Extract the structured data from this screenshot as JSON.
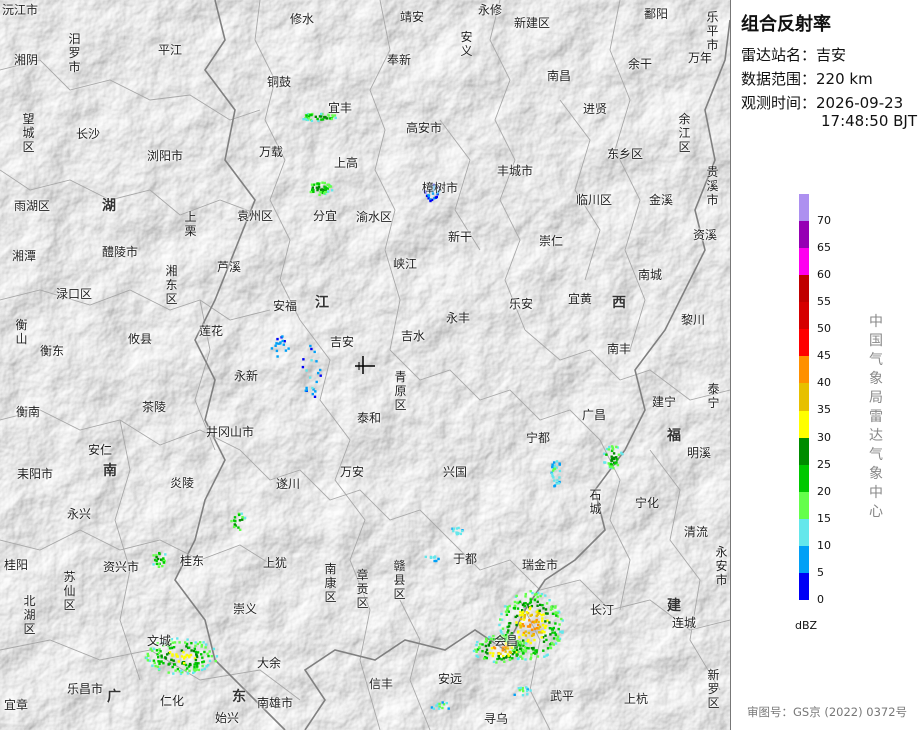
{
  "panel": {
    "title": "组合反射率",
    "station_label": "雷达站名：",
    "station": "吉安",
    "range_label": "数据范围：",
    "range": "220 km",
    "time_label": "观测时间：",
    "date": "2026-09-23",
    "time": "17:48:50 BJT",
    "unit": "dBZ",
    "agency": "中国气象局雷达气象中心",
    "approval": "审图号：GS京 (2022) 0372号"
  },
  "legend": {
    "levels": [
      {
        "value": "70",
        "color": "#ad90f0"
      },
      {
        "value": "65",
        "color": "#9600b4"
      },
      {
        "value": "60",
        "color": "#ff00f0"
      },
      {
        "value": "55",
        "color": "#c00000"
      },
      {
        "value": "50",
        "color": "#d60000"
      },
      {
        "value": "45",
        "color": "#ff0000"
      },
      {
        "value": "40",
        "color": "#ff9000"
      },
      {
        "value": "35",
        "color": "#e7c000"
      },
      {
        "value": "30",
        "color": "#ffff00"
      },
      {
        "value": "25",
        "color": "#008c00"
      },
      {
        "value": "20",
        "color": "#00c800"
      },
      {
        "value": "15",
        "color": "#64ff4b"
      },
      {
        "value": "10",
        "color": "#64e7eb"
      },
      {
        "value": "5",
        "color": "#01a0f6"
      },
      {
        "value": "0",
        "color": "#0000f6"
      }
    ]
  },
  "map": {
    "places": [
      {
        "id": "yuanjiang",
        "name": "沅江市"
      },
      {
        "id": "xiushui",
        "name": "修水"
      },
      {
        "id": "jingan",
        "name": "靖安"
      },
      {
        "id": "yongxiu",
        "name": "永修"
      },
      {
        "id": "xinjian",
        "name": "新建区"
      },
      {
        "id": "poyang",
        "name": "鄱阳"
      },
      {
        "id": "xiangyin",
        "name": "湘阴"
      },
      {
        "id": "pingjiang",
        "name": "平江"
      },
      {
        "id": "fengxin",
        "name": "奉新"
      },
      {
        "id": "nanchang",
        "name": "南昌"
      },
      {
        "id": "yugan",
        "name": "余干"
      },
      {
        "id": "wannian",
        "name": "万年"
      },
      {
        "id": "changsha",
        "name": "长沙"
      },
      {
        "id": "tonggu",
        "name": "铜鼓"
      },
      {
        "id": "yifeng",
        "name": "宜丰"
      },
      {
        "id": "jinxian",
        "name": "进贤"
      },
      {
        "id": "gaoan",
        "name": "高安市"
      },
      {
        "id": "liuyang",
        "name": "浏阳市"
      },
      {
        "id": "wanzai",
        "name": "万载"
      },
      {
        "id": "dongxiang",
        "name": "东乡区"
      },
      {
        "id": "shanggao",
        "name": "上高"
      },
      {
        "id": "fengcheng",
        "name": "丰城市"
      },
      {
        "id": "zhangshu",
        "name": "樟树市"
      },
      {
        "id": "yuhu",
        "name": "雨湖区"
      },
      {
        "id": "yuanzhou",
        "name": "袁州区"
      },
      {
        "id": "fenyi",
        "name": "分宜"
      },
      {
        "id": "yushui",
        "name": "渝水区"
      },
      {
        "id": "linchuan",
        "name": "临川区"
      },
      {
        "id": "jinxi",
        "name": "金溪"
      },
      {
        "id": "xingan",
        "name": "新干"
      },
      {
        "id": "chongren",
        "name": "崇仁"
      },
      {
        "id": "zixi",
        "name": "资溪"
      },
      {
        "id": "xiangtan",
        "name": "湘潭"
      },
      {
        "id": "liling",
        "name": "醴陵市"
      },
      {
        "id": "luxi",
        "name": "芦溪"
      },
      {
        "id": "xiajiang",
        "name": "峡江"
      },
      {
        "id": "nancheng",
        "name": "南城"
      },
      {
        "id": "lukou",
        "name": "渌口区"
      },
      {
        "id": "anfu",
        "name": "安福"
      },
      {
        "id": "lean",
        "name": "乐安"
      },
      {
        "id": "yihuang",
        "name": "宜黄"
      },
      {
        "id": "yongfeng",
        "name": "永丰"
      },
      {
        "id": "lichuan",
        "name": "黎川"
      },
      {
        "id": "lianhua",
        "name": "莲花"
      },
      {
        "id": "ji_an",
        "name": "吉安"
      },
      {
        "id": "jishui",
        "name": "吉水"
      },
      {
        "id": "hengdong",
        "name": "衡东"
      },
      {
        "id": "youxian",
        "name": "攸县"
      },
      {
        "id": "nanfeng",
        "name": "南丰"
      },
      {
        "id": "yongxin",
        "name": "永新"
      },
      {
        "id": "hengnan",
        "name": "衡南"
      },
      {
        "id": "chaling",
        "name": "茶陵"
      },
      {
        "id": "taihe",
        "name": "泰和"
      },
      {
        "id": "guangchang",
        "name": "广昌"
      },
      {
        "id": "jianning",
        "name": "建宁"
      },
      {
        "id": "jinggangshan",
        "name": "井冈山市"
      },
      {
        "id": "anren",
        "name": "安仁"
      },
      {
        "id": "ningdu",
        "name": "宁都"
      },
      {
        "id": "mingxi",
        "name": "明溪"
      },
      {
        "id": "leiyang",
        "name": "耒阳市"
      },
      {
        "id": "wanan",
        "name": "万安"
      },
      {
        "id": "xingguo",
        "name": "兴国"
      },
      {
        "id": "yanling",
        "name": "炎陵"
      },
      {
        "id": "suichuan",
        "name": "遂川"
      },
      {
        "id": "ninghua",
        "name": "宁化"
      },
      {
        "id": "yongxing",
        "name": "永兴"
      },
      {
        "id": "yudu",
        "name": "于都"
      },
      {
        "id": "qingliu",
        "name": "清流"
      },
      {
        "id": "zixing",
        "name": "资兴市"
      },
      {
        "id": "guidong",
        "name": "桂东"
      },
      {
        "id": "shangyou",
        "name": "上犹"
      },
      {
        "id": "ruijin",
        "name": "瑞金市"
      },
      {
        "id": "guiyang",
        "name": "桂阳"
      },
      {
        "id": "chongyi",
        "name": "崇义"
      },
      {
        "id": "changting",
        "name": "长汀"
      },
      {
        "id": "liancheng",
        "name": "连城"
      },
      {
        "id": "huichang",
        "name": "会昌"
      },
      {
        "id": "wencheng",
        "name": "文城"
      },
      {
        "id": "dayu",
        "name": "大余"
      },
      {
        "id": "xinfeng",
        "name": "信丰"
      },
      {
        "id": "anyuan",
        "name": "安远"
      },
      {
        "id": "lechang",
        "name": "乐昌市"
      },
      {
        "id": "renhua",
        "name": "仁化"
      },
      {
        "id": "nanxiong",
        "name": "南雄市"
      },
      {
        "id": "wuping",
        "name": "武平"
      },
      {
        "id": "shanghang",
        "name": "上杭"
      },
      {
        "id": "yizhang",
        "name": "宜章"
      },
      {
        "id": "shixing",
        "name": "始兴"
      },
      {
        "id": "xunwu",
        "name": "寻乌"
      }
    ],
    "vertical_places": [
      {
        "id": "miluo",
        "name": "汨罗市"
      },
      {
        "id": "anyi",
        "name": "安义"
      },
      {
        "id": "lepingshi",
        "name": "乐平市"
      },
      {
        "id": "wangcheng",
        "name": "望城区"
      },
      {
        "id": "yujiang",
        "name": "余江区"
      },
      {
        "id": "guixi",
        "name": "贵溪市"
      },
      {
        "id": "shangli",
        "name": "上栗"
      },
      {
        "id": "xiangdong",
        "name": "湘东区"
      },
      {
        "id": "hengshan",
        "name": "衡山"
      },
      {
        "id": "qingyuan",
        "name": "青原区"
      },
      {
        "id": "taining",
        "name": "泰宁"
      },
      {
        "id": "shicheng",
        "name": "石城"
      },
      {
        "id": "nankang",
        "name": "南康区"
      },
      {
        "id": "zhanggong",
        "name": "章贡区"
      },
      {
        "id": "ganxian",
        "name": "赣县区"
      },
      {
        "id": "suxian",
        "name": "苏仙区"
      },
      {
        "id": "beihu",
        "name": "北湖区"
      },
      {
        "id": "yongan",
        "name": "永安市"
      },
      {
        "id": "xinluo",
        "name": "新罗区"
      }
    ],
    "extra_labels": [
      {
        "id": "xiangtan2",
        "name": "湘潭"
      },
      {
        "id": "hengyang",
        "name": "衡南"
      }
    ],
    "provinces": [
      {
        "id": "hu",
        "name": "湖"
      },
      {
        "id": "jiang",
        "name": "江"
      },
      {
        "id": "xi",
        "name": "西"
      },
      {
        "id": "fu",
        "name": "福"
      },
      {
        "id": "nan",
        "name": "南"
      },
      {
        "id": "jian",
        "name": "建"
      },
      {
        "id": "guang",
        "name": "广"
      },
      {
        "id": "dong",
        "name": "东"
      }
    ]
  }
}
